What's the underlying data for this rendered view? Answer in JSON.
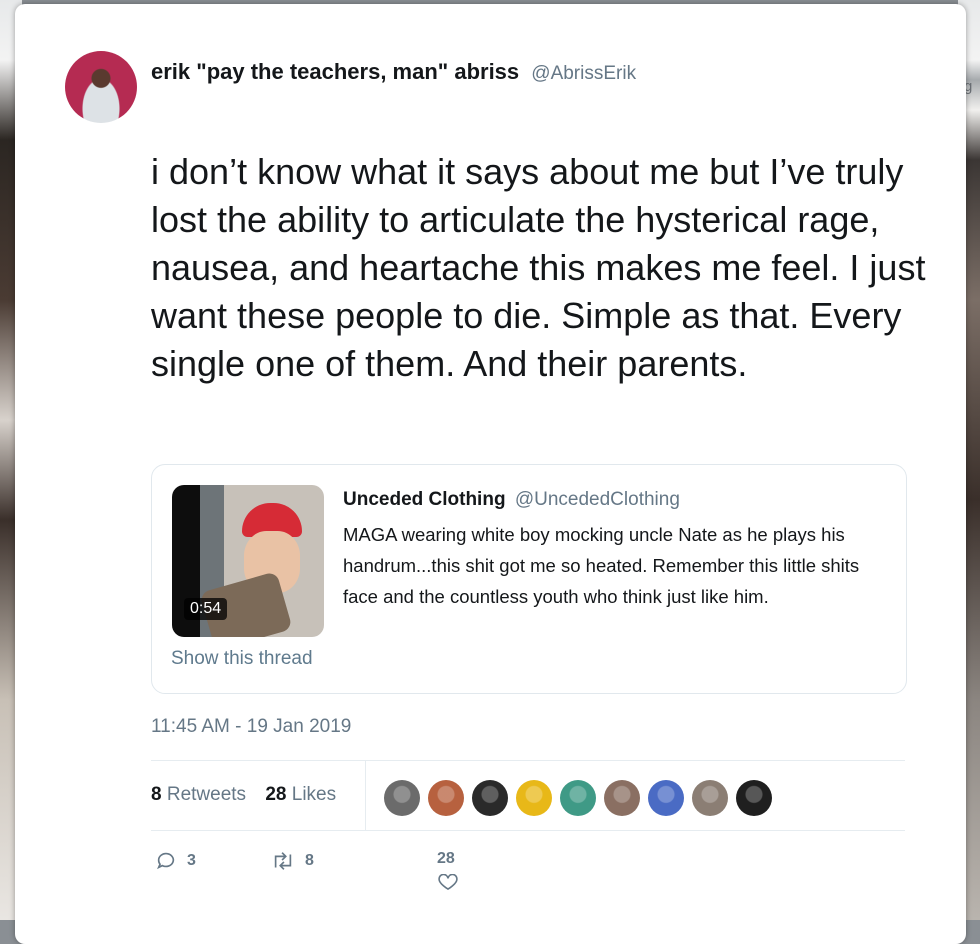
{
  "author": {
    "name": "erik \"pay the teachers, man\" abriss",
    "handle": "@AbrissErik"
  },
  "tweet": {
    "text": "i don’t know what it says about me but I’ve truly lost the ability to articulate the hysterical rage, nausea, and heartache this makes me feel. I just want these people to die. Simple as that. Every single one of them. And their parents.",
    "timestamp": "11:45 AM - 19 Jan 2019"
  },
  "quoted": {
    "name": "Unceded Clothing",
    "handle": "@UncededClothing",
    "text": "MAGA wearing white boy mocking uncle Nate as he plays his handrum...this shit got me so heated. Remember this little shits face and the countless youth who think just like him.",
    "video_duration": "0:54",
    "show_thread": "Show this thread"
  },
  "stats": {
    "retweets_count": "8",
    "retweets_label": "Retweets",
    "likes_count": "28",
    "likes_label": "Likes"
  },
  "likers": [
    {
      "color": "#6b6b6b"
    },
    {
      "color": "#b7613f"
    },
    {
      "color": "#2a2a2a"
    },
    {
      "color": "#e8b818"
    },
    {
      "color": "#3f9a86"
    },
    {
      "color": "#8a6f62"
    },
    {
      "color": "#4a6bc4"
    },
    {
      "color": "#8b7e74"
    },
    {
      "color": "#1f1f1f"
    }
  ],
  "actions": {
    "reply_count": "3",
    "retweet_count": "8",
    "like_count": "28"
  },
  "background": {
    "right_edge_letter": "g"
  },
  "colors": {
    "text": "#14171a",
    "secondary": "#657786",
    "border": "#e1e8ed"
  }
}
